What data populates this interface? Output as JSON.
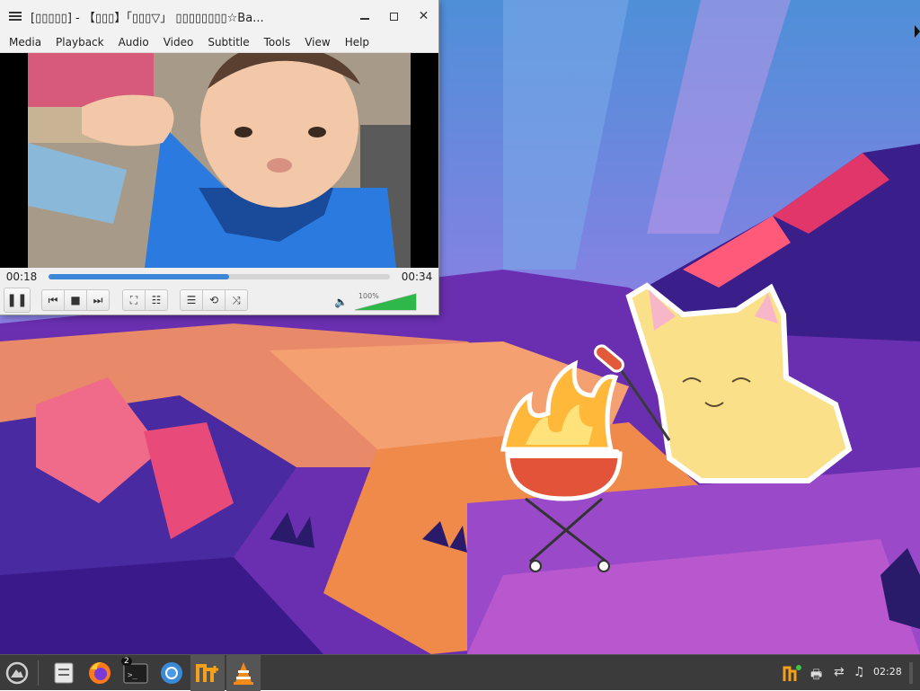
{
  "window": {
    "title": "[▯▯▯▯▯] - 【▯▯▯】「▯▯▯▽」 ▯▯▯▯▯▯▯▯☆Ba...",
    "menu": [
      "Media",
      "Playback",
      "Audio",
      "Video",
      "Subtitle",
      "Tools",
      "View",
      "Help"
    ]
  },
  "player": {
    "elapsed": "00:18",
    "total": "00:34",
    "progress": 0.53,
    "volume_label": "100%",
    "volume": 1.0
  },
  "icons": {
    "menu": "hamburger-icon",
    "minimize": "minimize-icon",
    "maximize": "maximize-icon",
    "close": "close-icon",
    "pause": "pause-icon",
    "prev": "previous-icon",
    "stop": "stop-icon",
    "next": "next-icon",
    "fullscreen": "fullscreen-icon",
    "extended": "extended-settings-icon",
    "playlist": "playlist-icon",
    "loop": "loop-icon",
    "random": "shuffle-icon",
    "speaker": "speaker-icon"
  },
  "taskbar": {
    "clock": "02:28",
    "terminal_badge": "2",
    "colors": {
      "background": "#3b3b3b",
      "vlc_cone": "#f28a1a",
      "seek": "#3d87d8",
      "volume": "#2fb84a"
    }
  }
}
